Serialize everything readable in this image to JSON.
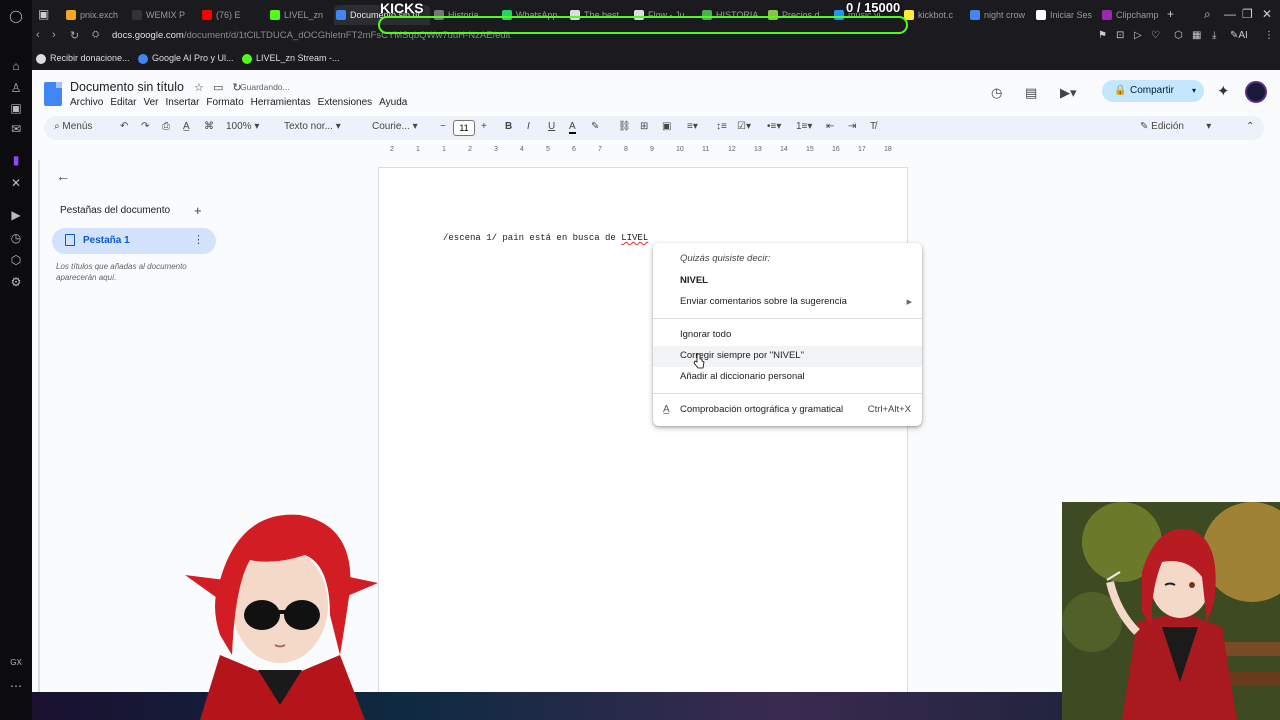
{
  "overlay": {
    "goal_label": "KICKS",
    "goal_count": "0  / 15000"
  },
  "browser": {
    "tabs": [
      {
        "label": "pnix.exch",
        "color": "#f5a623"
      },
      {
        "label": "WEMIX P",
        "color": "#333"
      },
      {
        "label": "(76) E",
        "color": "#ff0000"
      },
      {
        "label": "LIVEL_zn",
        "color": "#53fc18"
      },
      {
        "label": "Documento sin tít",
        "color": "#4285f4"
      },
      {
        "label": "Historia",
        "color": "#777"
      },
      {
        "label": "WhatsApp",
        "color": "#25d366"
      },
      {
        "label": "The best",
        "color": "#ddd"
      },
      {
        "label": "Flow - Ju",
        "color": "#ddd"
      },
      {
        "label": "HISTORIA",
        "color": "#4caf50"
      },
      {
        "label": "Precios d",
        "color": "#8bc34a"
      },
      {
        "label": "music vi",
        "color": "#2196f3"
      },
      {
        "label": "kickbot.c",
        "color": "#ffeb3b"
      },
      {
        "label": "night crow",
        "color": "#4285f4"
      },
      {
        "label": "Iniciar Ses",
        "color": "#fff"
      },
      {
        "label": "Clipchamp",
        "color": "#9c27b0"
      }
    ],
    "url_host": "docs.google.com",
    "url_path": "/document/d/1tClLTDUCA_dOCGhletnFT2mFsCYMSqbQWw7uuH-NzAE/edit",
    "bookmarks": [
      {
        "label": "Recibir donacione...",
        "color": "#ddd"
      },
      {
        "label": "Google AI Pro y Ul...",
        "color": "#4285f4"
      },
      {
        "label": "LIVEL_zn Stream -...",
        "color": "#53fc18"
      }
    ]
  },
  "docs": {
    "title": "Documento sin título",
    "saving_status": "Guardando...",
    "menu": [
      "Archivo",
      "Editar",
      "Ver",
      "Insertar",
      "Formato",
      "Herramientas",
      "Extensiones",
      "Ayuda"
    ],
    "share_label": "Compartir",
    "toolbar": {
      "menus_label": "Menús",
      "zoom": "100%",
      "style": "Texto nor...",
      "font": "Courie...",
      "font_size": "11",
      "mode": "Edición"
    },
    "ruler_ticks": [
      "2",
      "1",
      "1",
      "2",
      "3",
      "4",
      "5",
      "6",
      "7",
      "8",
      "9",
      "10",
      "11",
      "12",
      "13",
      "14",
      "15",
      "16",
      "17",
      "18"
    ],
    "sidebar": {
      "heading": "Pestañas del documento",
      "tab_label": "Pestaña 1",
      "hint": "Los títulos que añadas al documento aparecerán aquí."
    },
    "document": {
      "text_before": "/escena 1/ pain está en busca de ",
      "misspelled_word": "LIVEL"
    },
    "context_menu": {
      "header": "Quizás quisiste decir:",
      "suggestion": "NIVEL",
      "feedback": "Enviar comentarios sobre la sugerencia",
      "ignore_all": "Ignorar todo",
      "always_correct": "Corregir siempre por \"NIVEL\"",
      "add_dictionary": "Añadir al diccionario personal",
      "spellcheck": "Comprobación ortográfica y gramatical",
      "spellcheck_shortcut": "Ctrl+Alt+X"
    }
  },
  "rail": {
    "bottom_label": "GX"
  }
}
